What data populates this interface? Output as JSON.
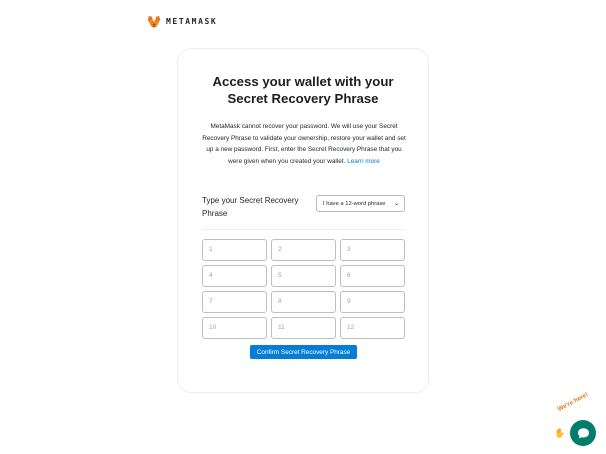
{
  "header": {
    "brand": "METAMASK",
    "logo_icon": "metamask-fox-icon"
  },
  "card": {
    "title_line1": "Access your wallet with your",
    "title_line2": "Secret Recovery Phrase",
    "description": "MetaMask cannot recover your password. We will use your Secret Recovery Phrase to validate your ownership, restore your wallet and set up a new password. First, enter the Secret Recovery Phrase that you were given when you created your wallet.",
    "learn_more": "Learn more",
    "type_label": "Type your Secret Recovery Phrase",
    "phrase_select": "I have a 12-word phrase",
    "word_fields": [
      {
        "placeholder": "1"
      },
      {
        "placeholder": "2"
      },
      {
        "placeholder": "3"
      },
      {
        "placeholder": "4"
      },
      {
        "placeholder": "5"
      },
      {
        "placeholder": "6"
      },
      {
        "placeholder": "7"
      },
      {
        "placeholder": "8"
      },
      {
        "placeholder": "9"
      },
      {
        "placeholder": "10"
      },
      {
        "placeholder": "11"
      },
      {
        "placeholder": "12"
      }
    ],
    "confirm_button": "Confirm Secret Recovery Phrase"
  },
  "help_widget": {
    "text": "We're here!",
    "icon": "chat-bubble-icon",
    "accent": "#037d6b"
  },
  "colors": {
    "primary": "#037dd6",
    "text": "#24272a",
    "border": "#bbc0c5"
  }
}
